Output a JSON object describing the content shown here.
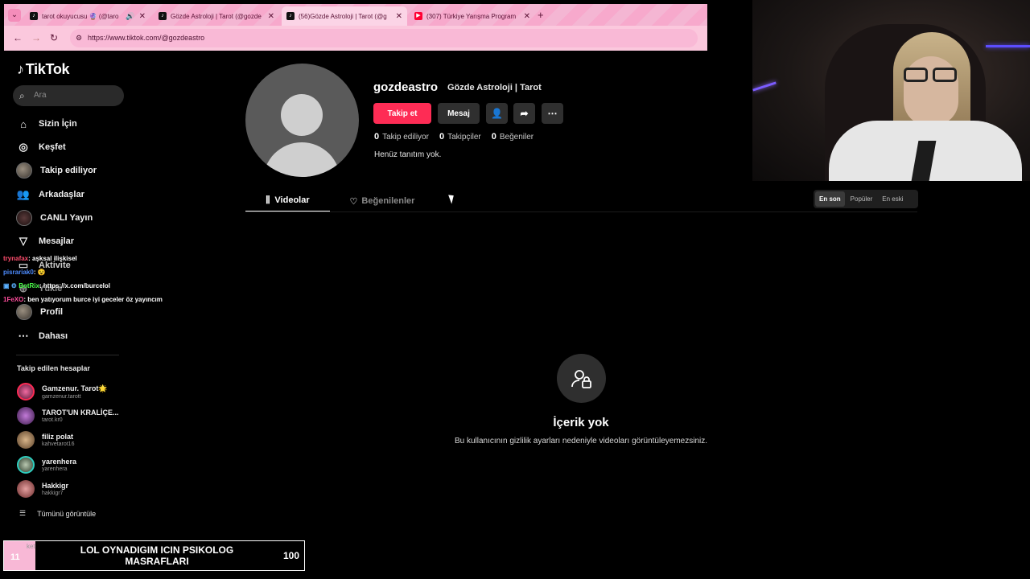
{
  "browser": {
    "tabs": [
      {
        "title": "tarot okuyucusu 🔮 (@taro",
        "favicon": "tiktok"
      },
      {
        "title": "Gözde Astroloji | Tarot (@gozde",
        "favicon": "tiktok"
      },
      {
        "title": "(56)Gözde Astroloji | Tarot (@g",
        "favicon": "tiktok"
      },
      {
        "title": "(307) Türkiye Yarışma Program",
        "favicon": "youtube"
      }
    ],
    "url": "https://www.tiktok.com/@gozdeastro"
  },
  "sidebar": {
    "logo": "TikTok",
    "search_placeholder": "Ara",
    "nav": [
      {
        "label": "Sizin İçin",
        "icon": "home-icon"
      },
      {
        "label": "Keşfet",
        "icon": "compass-icon"
      },
      {
        "label": "Takip ediliyor",
        "icon": "avatar"
      },
      {
        "label": "Arkadaşlar",
        "icon": "friends-icon"
      },
      {
        "label": "CANLI Yayın",
        "icon": "live-icon"
      },
      {
        "label": "Mesajlar",
        "icon": "paper-plane-icon"
      },
      {
        "label": "Aktivite",
        "icon": "activity-icon"
      },
      {
        "label": "Yükle",
        "icon": "upload-icon"
      },
      {
        "label": "Profil",
        "icon": "avatar"
      },
      {
        "label": "Dahası",
        "icon": "more-icon"
      }
    ],
    "following_title": "Takip edilen hesaplar",
    "accounts": [
      {
        "name": "Gamzenur. Tarot🌟",
        "handle": "gamzenur.tarott"
      },
      {
        "name": "TAROT'UN KRALİÇE...",
        "handle": "tarot.kr0"
      },
      {
        "name": "filiz polat",
        "handle": "kahvetarot16"
      },
      {
        "name": "yarenhera",
        "handle": "yarenhera"
      },
      {
        "name": "Hakkigr",
        "handle": "hakkigr7"
      }
    ],
    "see_all": "Tümünü görüntüle"
  },
  "chat": [
    {
      "user": "trynafax",
      "msg": ": aşksal ilişkisel",
      "color": "#ff4d6d"
    },
    {
      "user": "pisrariak0",
      "msg": ": 😵",
      "color": "#4d8cff"
    },
    {
      "user": "BotRix",
      "msg": ": https://x.com/burcelol",
      "color": "#4cff4c"
    },
    {
      "user": "1FeXO",
      "msg": ": ben yatıyorum burce iyi geceler öz yayıncım",
      "color": "#ff4d9d"
    }
  ],
  "profile": {
    "username": "gozdeastro",
    "display_name": "Gözde Astroloji | Tarot",
    "follow_btn": "Takip et",
    "message_btn": "Mesaj",
    "stats": [
      {
        "value": "0",
        "label": "Takip ediliyor"
      },
      {
        "value": "0",
        "label": "Takipçiler"
      },
      {
        "value": "0",
        "label": "Beğeniler"
      }
    ],
    "bio": "Henüz tanıtım yok.",
    "tabs": {
      "videos": "Videolar",
      "liked": "Beğenilenler"
    },
    "sort": [
      "En son",
      "Popüler",
      "En eski"
    ],
    "empty_title": "İçerik yok",
    "empty_subtitle": "Bu kullanıcının gizlilik ayarları nedeniyle videoları görüntüleyemezsiniz."
  },
  "goal": {
    "number": "11",
    "ket": "ket",
    "title": "LOL OYNADIGIM ICIN PSIKOLOG MASRAFLARI",
    "count": "100"
  },
  "colors": {
    "accent": "#fe2c55",
    "chrome": "#f7a9cc"
  }
}
